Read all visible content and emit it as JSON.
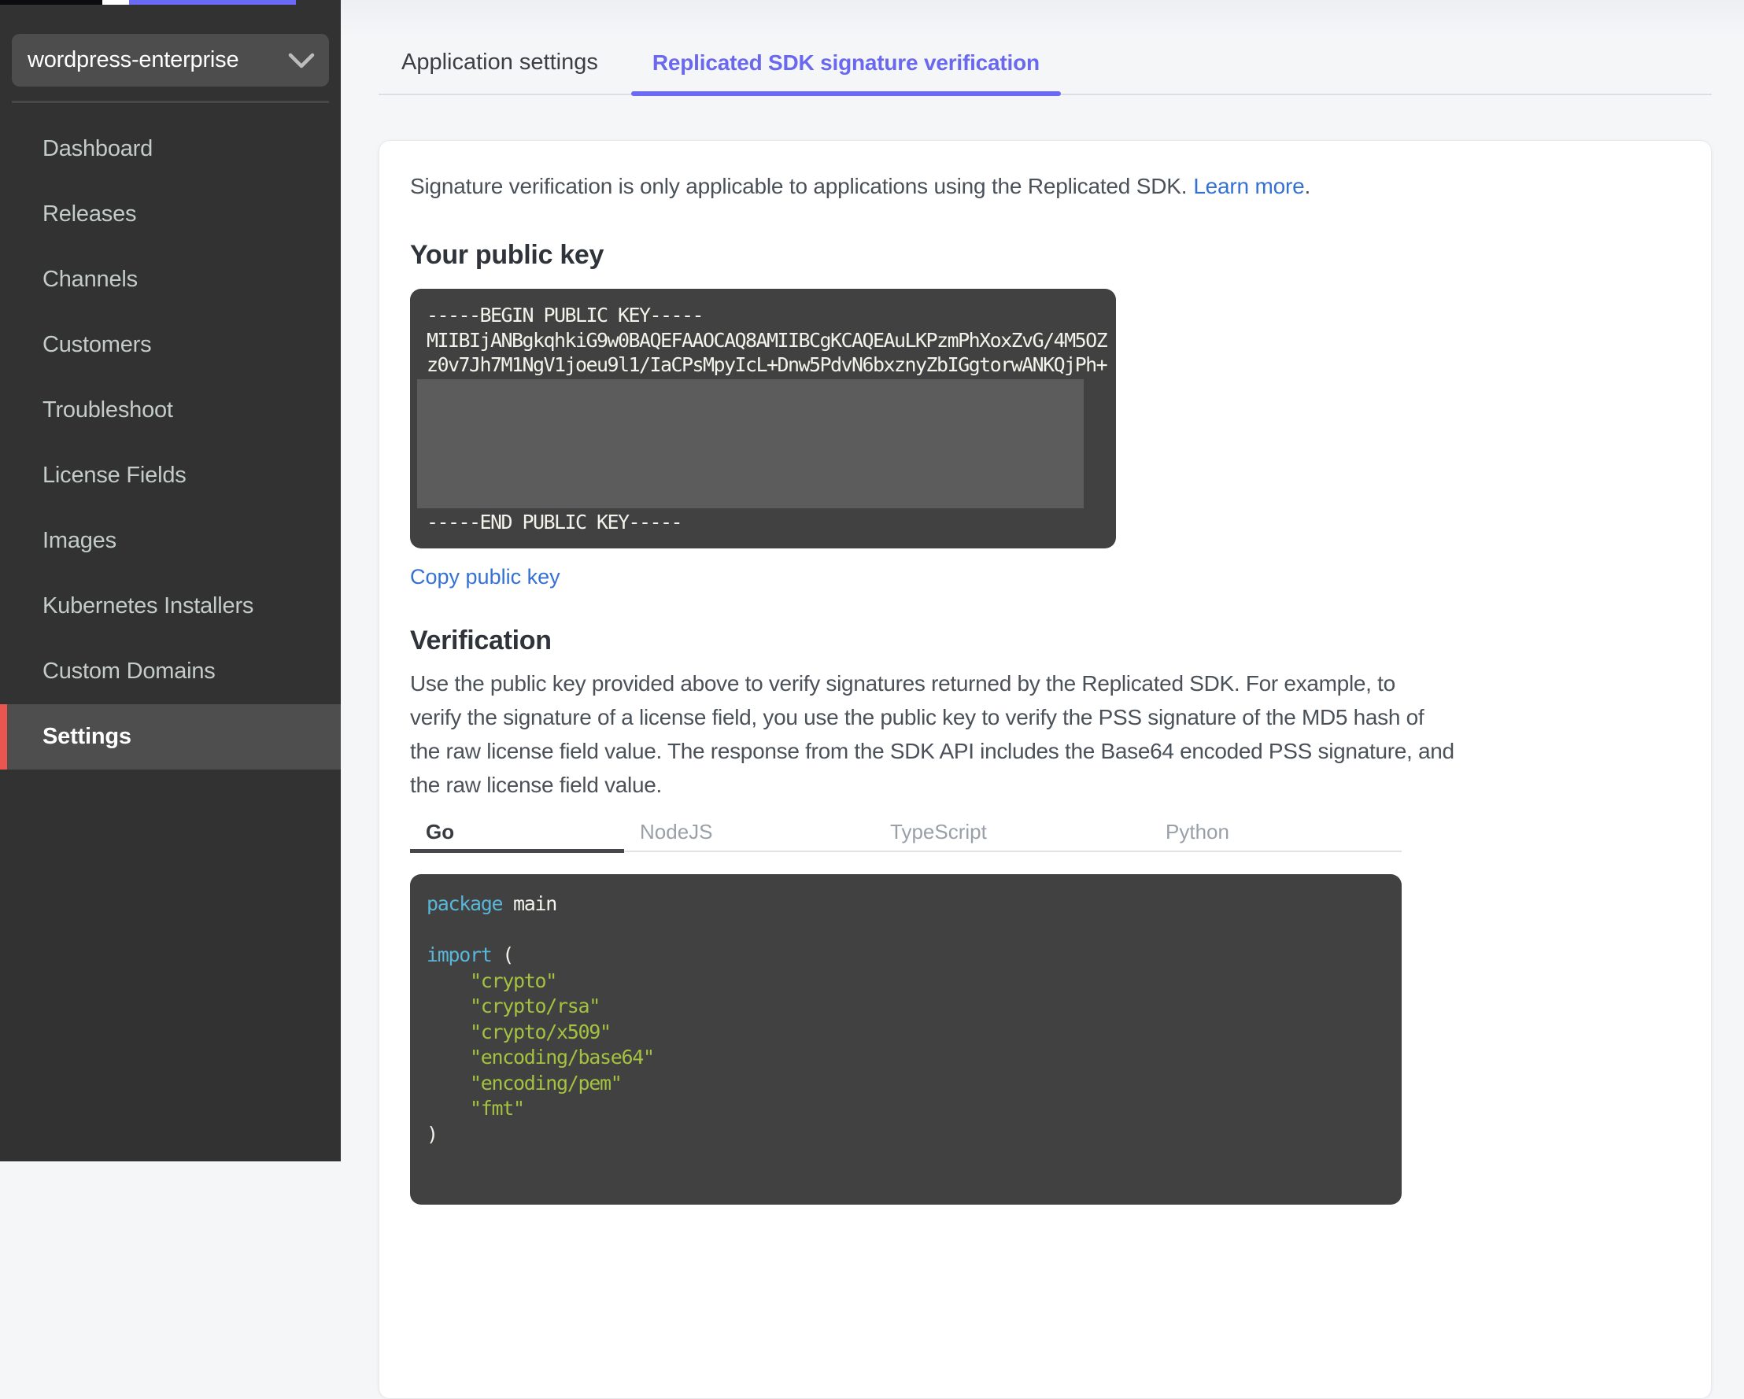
{
  "sidebar": {
    "app_selector": {
      "value": "wordpress-enterprise"
    },
    "items": [
      {
        "label": "Dashboard",
        "active": false
      },
      {
        "label": "Releases",
        "active": false
      },
      {
        "label": "Channels",
        "active": false
      },
      {
        "label": "Customers",
        "active": false
      },
      {
        "label": "Troubleshoot",
        "active": false
      },
      {
        "label": "License Fields",
        "active": false
      },
      {
        "label": "Images",
        "active": false
      },
      {
        "label": "Kubernetes Installers",
        "active": false
      },
      {
        "label": "Custom Domains",
        "active": false
      },
      {
        "label": "Settings",
        "active": true
      }
    ]
  },
  "header_tabs": [
    {
      "label": "Application settings",
      "active": false
    },
    {
      "label": "Replicated SDK signature verification",
      "active": true
    }
  ],
  "content": {
    "intro": {
      "text": "Signature verification is only applicable to applications using the Replicated SDK.",
      "link_label": "Learn more",
      "suffix": "."
    },
    "public_key": {
      "title": "Your public key",
      "pem_lines": [
        "-----BEGIN PUBLIC KEY-----",
        "MIIBIjANBgkqhkiG9w0BAQEFAAOCAQ8AMIIBCgKCAQEAuLKPzmPhXoxZvG/4M5OZ",
        "z0v7Jh7M1NgV1joeu9l1/IaCPsMpyIcL+Dnw5PdvN6bxznyZbIGgtorwANKQjPh+"
      ],
      "pem_end_line": "-----END PUBLIC KEY-----",
      "copy_link_label": "Copy public key"
    },
    "verification": {
      "title": "Verification",
      "description_lines": [
        "Use the public key provided above to verify signatures returned by the Replicated SDK. For example, to",
        "verify the signature of a license field, you use the public key to verify the PSS signature of the MD5 hash of",
        "the raw license field value. The response from the SDK API includes the Base64 encoded PSS signature, and",
        "the raw license field value."
      ],
      "language_tabs": [
        "Go",
        "NodeJS",
        "TypeScript",
        "Python"
      ],
      "active_language": "Go",
      "code_lines": [
        [
          {
            "t": "package",
            "c": "kw"
          },
          {
            "t": " main",
            "c": "pl"
          }
        ],
        [],
        [
          {
            "t": "import",
            "c": "kw"
          },
          {
            "t": " (",
            "c": "pl"
          }
        ],
        [
          {
            "t": "    ",
            "c": "pl"
          },
          {
            "t": "\"crypto\"",
            "c": "str"
          }
        ],
        [
          {
            "t": "    ",
            "c": "pl"
          },
          {
            "t": "\"crypto/rsa\"",
            "c": "str"
          }
        ],
        [
          {
            "t": "    ",
            "c": "pl"
          },
          {
            "t": "\"crypto/x509\"",
            "c": "str"
          }
        ],
        [
          {
            "t": "    ",
            "c": "pl"
          },
          {
            "t": "\"encoding/base64\"",
            "c": "str"
          }
        ],
        [
          {
            "t": "    ",
            "c": "pl"
          },
          {
            "t": "\"encoding/pem\"",
            "c": "str"
          }
        ],
        [
          {
            "t": "    ",
            "c": "pl"
          },
          {
            "t": "\"fmt\"",
            "c": "str"
          }
        ],
        [
          {
            "t": ")",
            "c": "pl"
          }
        ]
      ]
    }
  },
  "colors": {
    "accent_red": "#e9564f",
    "tab_active_purple": "#6b6af3",
    "link_blue": "#3471d3",
    "sidebar_bg": "#323232",
    "code_bg": "#414141",
    "code_keyword": "#58b6d8",
    "code_string": "#a4c23f",
    "redacted_gray": "#5c5c5c",
    "topbar_purple": "#6b6af7"
  }
}
